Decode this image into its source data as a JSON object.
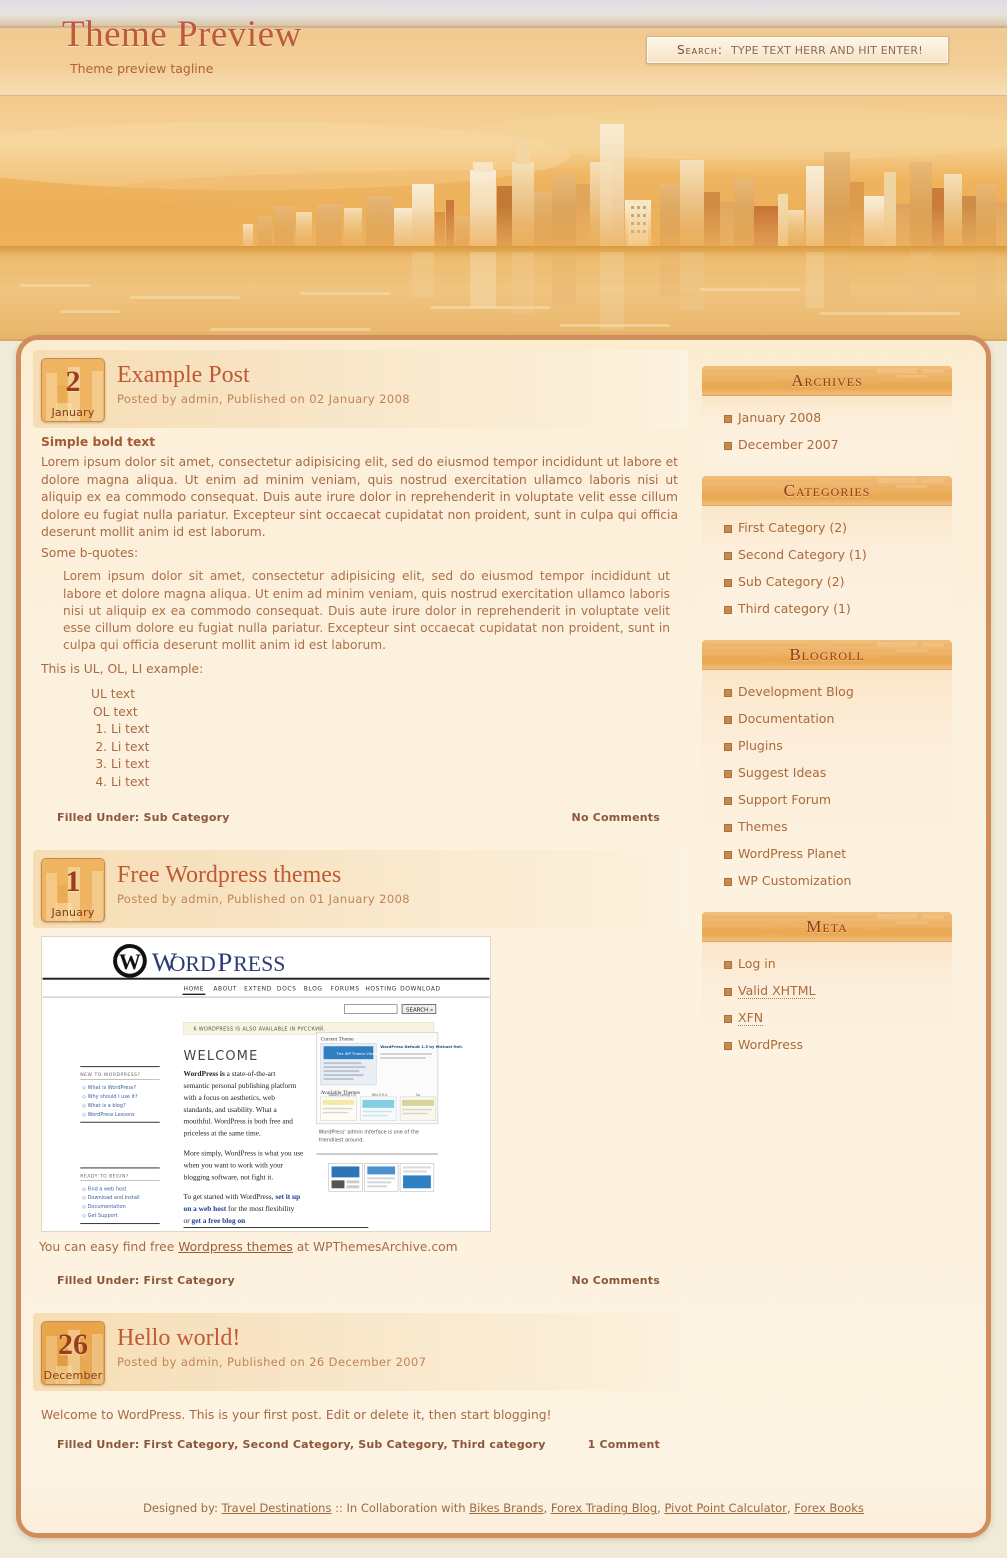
{
  "header": {
    "blog_title": "Theme Preview",
    "tagline": "Theme preview tagline",
    "search_label": "Search:",
    "search_placeholder": "Type text herr and hit enter!",
    "search_value": ""
  },
  "banner": {
    "alt": "sunset city skyline with water reflection"
  },
  "posts": [
    {
      "day": "2",
      "month": "January",
      "title": "Example Post",
      "meta": "Posted by admin, Published on 02 January 2008",
      "bold_lead": "Simple bold text",
      "para1": "Lorem ipsum dolor sit amet, consectetur adipisicing elit, sed do eiusmod tempor incididunt ut labore et dolore magna aliqua. Ut enim ad minim veniam, quis nostrud exercitation ullamco laboris nisi ut aliquip ex ea commodo consequat. Duis aute irure dolor in reprehenderit in voluptate velit esse cillum dolore eu fugiat nulla pariatur. Excepteur sint occaecat cupidatat non proident, sunt in culpa qui officia deserunt mollit anim id est laborum.",
      "bquote_intro": "Some b-quotes:",
      "blockquote": "Lorem ipsum dolor sit amet, consectetur adipisicing elit, sed do eiusmod tempor incididunt ut labore et dolore magna aliqua. Ut enim ad minim veniam, quis nostrud exercitation ullamco laboris nisi ut aliquip ex ea commodo consequat. Duis aute irure dolor in reprehenderit in voluptate velit esse cillum dolore eu fugiat nulla pariatur. Excepteur sint occaecat cupidatat non proident, sunt in culpa qui officia deserunt mollit anim id est laborum.",
      "list_intro": "This is UL, OL, LI example:",
      "ul_text": "UL text",
      "ol_text": "OL text",
      "li_items": [
        "Li text",
        "Li text",
        "Li text",
        "Li text"
      ],
      "filed_under": "Filled Under: Sub Category",
      "comments": "No Comments"
    },
    {
      "day": "1",
      "month": "January",
      "title": "Free Wordpress themes",
      "meta": "Posted by admin, Published on 01 January 2008",
      "caption_before": "You can easy find free ",
      "caption_link": "Wordpress themes",
      "caption_after": " at WPThemesArchive.com",
      "filed_under": "Filled Under: First Category",
      "comments": "No Comments",
      "screenshot": {
        "brand": "WordPress",
        "nav": [
          "HOME",
          "ABOUT",
          "EXTEND",
          "DOCS",
          "BLOG",
          "FORUMS",
          "HOSTING",
          "DOWNLOAD"
        ],
        "search_button": "SEARCH »",
        "notice": "6 WORDPRESS IS ALSO AVAILABLE IN РУССКИЙ.",
        "welcome": "WELCOME",
        "left_head_1": "NEW TO WORDPRESS?",
        "left_links_1": [
          "What is WordPress?",
          "Why should I use it?",
          "What is a blog?",
          "WordPress Lessons"
        ],
        "left_head_2": "READY TO BEGIN?",
        "left_links_2": [
          "Find a web host",
          "Download and Install",
          "Documentation",
          "Get Support"
        ],
        "body_1_bold": "WordPress is",
        "body_1": " a state-of-the-art semantic personal publishing platform with a focus on aesthetics, web standards, and usability. What a mouthful. WordPress is both free and priceless at the same time.",
        "body_2": "More simply, WordPress is what you use when you want to work with your blogging software, not fight it.",
        "body_3a": "To get started with WordPress, ",
        "body_3b": "set it up on a web host",
        "body_3c": " for the most flexibility or ",
        "body_3d": "get a free blog on WordPress.com",
        "body_3e": ".",
        "right_panel_title": "Current Theme",
        "right_theme_name": "WordPress Default 1.5 by Michael Heilemann",
        "right_available": "Available Themes",
        "right_caption": "WordPress' admin interface is one of the friendliest around."
      }
    },
    {
      "day": "26",
      "month": "December",
      "title": "Hello world!",
      "meta": "Posted by admin, Published on 26 December 2007",
      "para1": "Welcome to WordPress. This is your first post. Edit or delete it, then start blogging!",
      "filed_under": "Filled Under: First Category, Second Category, Sub Category, Third category",
      "comments": "1 Comment"
    }
  ],
  "sidebar": {
    "widgets": [
      {
        "title": "Archives",
        "items": [
          {
            "label": "January 2008"
          },
          {
            "label": "December 2007"
          }
        ]
      },
      {
        "title": "Categories",
        "items": [
          {
            "label": "First Category (2)"
          },
          {
            "label": "Second Category (1)"
          },
          {
            "label": "Sub Category (2)"
          },
          {
            "label": "Third category (1)"
          }
        ]
      },
      {
        "title": "Blogroll",
        "items": [
          {
            "label": "Development Blog"
          },
          {
            "label": "Documentation"
          },
          {
            "label": "Plugins"
          },
          {
            "label": "Suggest Ideas"
          },
          {
            "label": "Support Forum"
          },
          {
            "label": "Themes"
          },
          {
            "label": "WordPress Planet"
          },
          {
            "label": "WP Customization"
          }
        ]
      },
      {
        "title": "Meta",
        "items": [
          {
            "label": "Log in"
          },
          {
            "label": "Valid XHTML",
            "abbr": true
          },
          {
            "label": "XFN",
            "abbr": true
          },
          {
            "label": "WordPress"
          }
        ]
      }
    ]
  },
  "footer": {
    "prefix": "Designed by: ",
    "designer": "Travel Destinations",
    "mid": " :: In Collaboration with ",
    "links": [
      "Bikes Brands",
      "Forex Trading Blog",
      "Pivot Point Calculator",
      "Forex Books"
    ],
    "sep": ", "
  },
  "colors": {
    "accent": "#c05a34",
    "title": "#bf593d",
    "body_text": "#a86a46",
    "border": "#d08e5c",
    "widget_head": "#e9a850"
  }
}
